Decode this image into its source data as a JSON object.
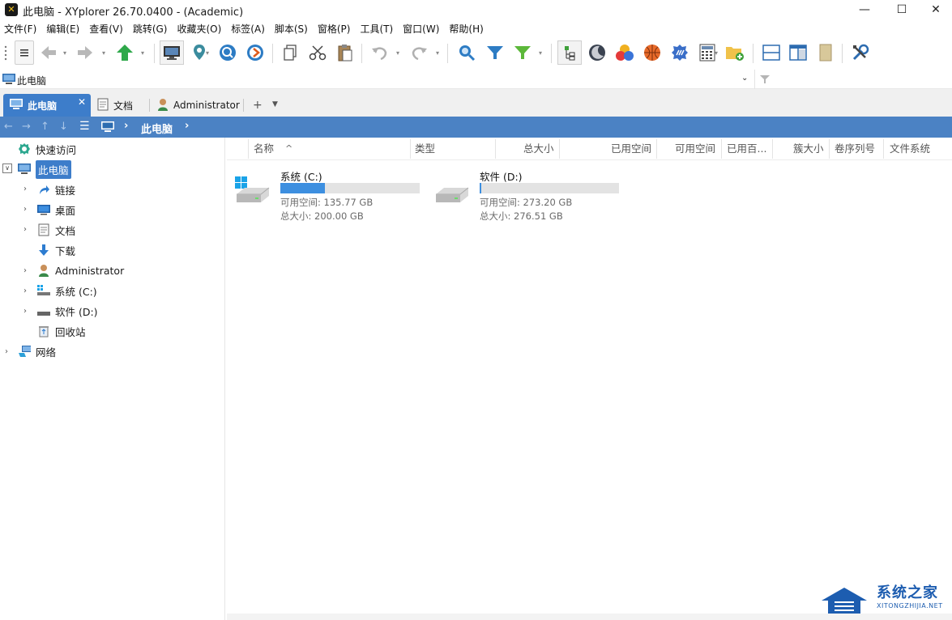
{
  "window": {
    "title": "此电脑 - XYplorer 26.70.0400 - (Academic)",
    "min_glyph": "—",
    "max_glyph": "☐",
    "close_glyph": "✕"
  },
  "menu": [
    "文件(F)",
    "编辑(E)",
    "查看(V)",
    "跳转(G)",
    "收藏夹(O)",
    "标签(A)",
    "脚本(S)",
    "窗格(P)",
    "工具(T)",
    "窗口(W)",
    "帮助(H)"
  ],
  "address": {
    "text": "此电脑",
    "dropdown": "⌄"
  },
  "tabs": {
    "active": "此电脑",
    "close": "✕",
    "tab2": "文档",
    "tab3": "Administrator",
    "add": "+",
    "more": "▼"
  },
  "breadcrumb": {
    "back": "←",
    "forward": "→",
    "up": "↑",
    "down": "↓",
    "menu": "☰",
    "arrow": "›",
    "label": "此电脑"
  },
  "tree": {
    "quick_access": "快速访问",
    "this_pc": "此电脑",
    "links": "链接",
    "desktop": "桌面",
    "documents": "文档",
    "downloads": "下载",
    "admin": "Administrator",
    "drive_c": "系统 (C:)",
    "drive_d": "软件 (D:)",
    "recycle": "回收站",
    "network": "网络",
    "collapsed_glyph": "›",
    "expanded_glyph": "∨"
  },
  "columns": {
    "name": "名称",
    "sort_indicator": "^",
    "type": "类型",
    "total": "总大小",
    "used": "已用空间",
    "free": "可用空间",
    "used_pct": "已用百...",
    "cluster": "簇大小",
    "serial": "卷序列号",
    "fs": "文件系统"
  },
  "drives": [
    {
      "name": "系统 (C:)",
      "free": "可用空间: 135.77 GB",
      "total": "总大小: 200.00 GB",
      "used_fraction": 0.32
    },
    {
      "name": "软件 (D:)",
      "free": "可用空间: 273.20 GB",
      "total": "总大小: 276.51 GB",
      "used_fraction": 0.012
    }
  ],
  "watermark": {
    "title": "系统之家",
    "subtitle": "XITONGZHIJIA.NET"
  },
  "colors": {
    "accent": "#3d7dca",
    "breadcrumb_bg": "#4b82c4",
    "drive_bar": "#3d8fe0"
  }
}
